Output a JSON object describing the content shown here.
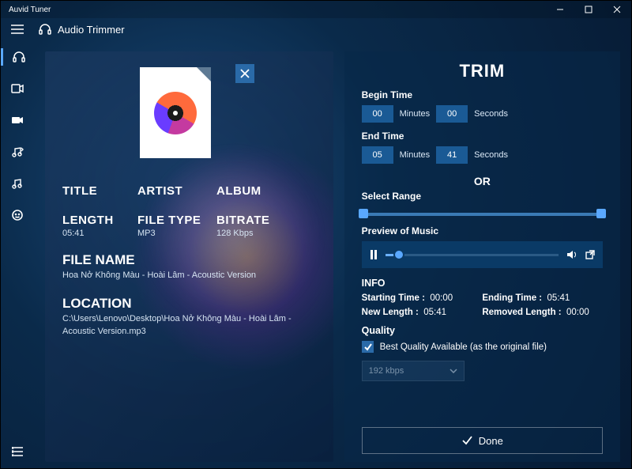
{
  "app": {
    "title": "Auvid Tuner"
  },
  "header": {
    "section": "Audio Trimmer"
  },
  "left": {
    "labels": {
      "title": "TITLE",
      "artist": "ARTIST",
      "album": "ALBUM",
      "length": "LENGTH",
      "filetype": "FILE TYPE",
      "bitrate": "BITRATE",
      "filename": "FILE NAME",
      "location": "LOCATION"
    },
    "values": {
      "length": "05:41",
      "filetype": "MP3",
      "bitrate": "128 Kbps",
      "filename": "Hoa Nở Không Màu - Hoài Lâm - Acoustic Version",
      "location": "C:\\Users\\Lenovo\\Desktop\\Hoa Nở Không Màu - Hoài Lâm - Acoustic Version.mp3"
    }
  },
  "right": {
    "title": "TRIM",
    "begin": {
      "label": "Begin Time",
      "min": "00",
      "sec": "00",
      "min_unit": "Minutes",
      "sec_unit": "Seconds"
    },
    "end": {
      "label": "End Time",
      "min": "05",
      "sec": "41",
      "min_unit": "Minutes",
      "sec_unit": "Seconds"
    },
    "or": "OR",
    "select_range": "Select Range",
    "preview": "Preview of Music",
    "info": {
      "header": "INFO",
      "start_label": "Starting Time :",
      "start_val": "00:00",
      "end_label": "Ending Time :",
      "end_val": "05:41",
      "new_label": "New Length :",
      "new_val": "05:41",
      "rem_label": "Removed Length :",
      "rem_val": "00:00"
    },
    "quality": {
      "header": "Quality",
      "checkbox": "Best Quality Available (as the original file)",
      "select": "192 kbps"
    },
    "done": "Done"
  }
}
